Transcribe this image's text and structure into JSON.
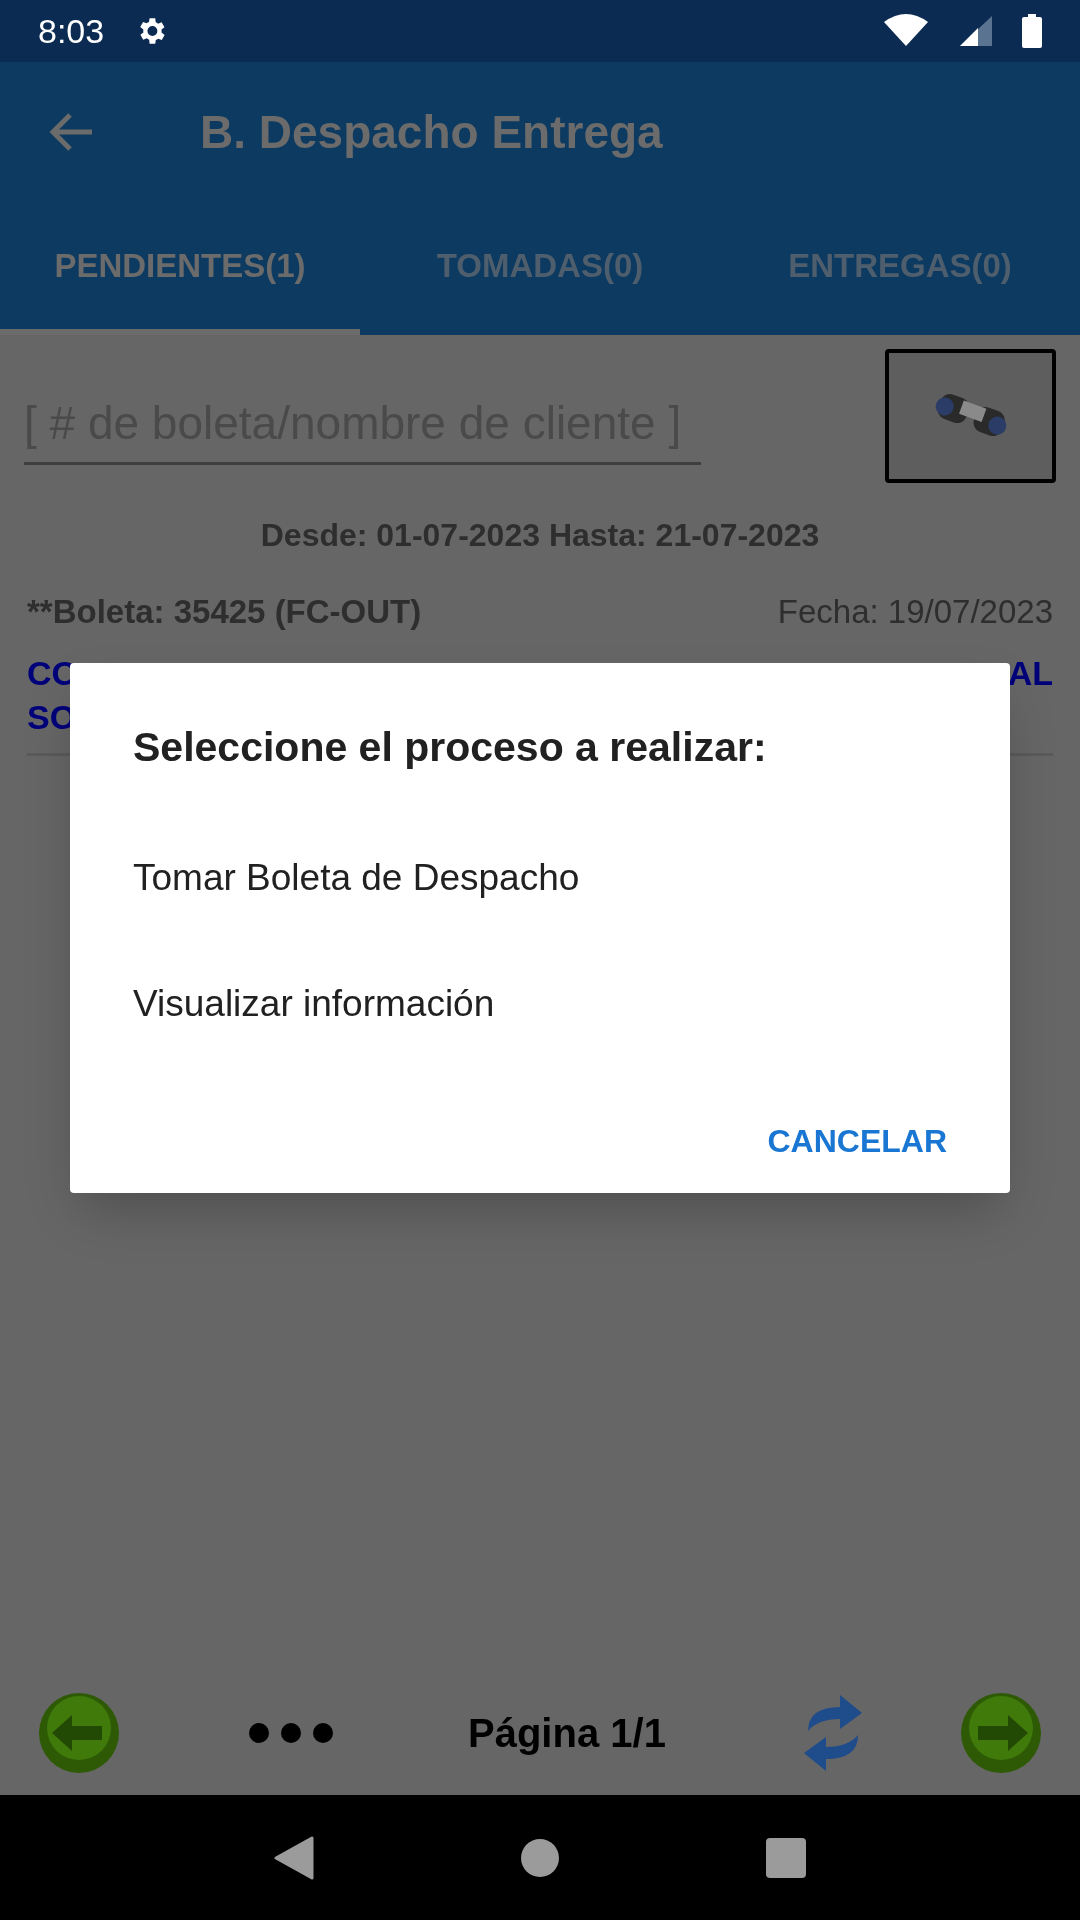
{
  "status_bar": {
    "time": "8:03"
  },
  "app_bar": {
    "title": "B. Despacho Entrega"
  },
  "tabs": [
    {
      "label": "PENDIENTES(1)",
      "selected": true
    },
    {
      "label": "TOMADAS(0)",
      "selected": false
    },
    {
      "label": "ENTREGAS(0)",
      "selected": false
    }
  ],
  "search": {
    "placeholder": "[ # de boleta/nombre de cliente ]"
  },
  "date_range": "Desde: 01-07-2023 Hasta: 21-07-2023",
  "record": {
    "boleta": "**Boleta: 35425 (FC-OUT)",
    "fecha": "Fecha: 19/07/2023",
    "client_line_1_start": "CO",
    "client_line_1_end": "AL",
    "client_line_2_start": "SO"
  },
  "dialog": {
    "title": "Seleccione el proceso a realizar:",
    "options": [
      "Tomar Boleta de Despacho",
      "Visualizar información"
    ],
    "cancel": "CANCELAR"
  },
  "pager": {
    "page": "Página 1/1"
  }
}
